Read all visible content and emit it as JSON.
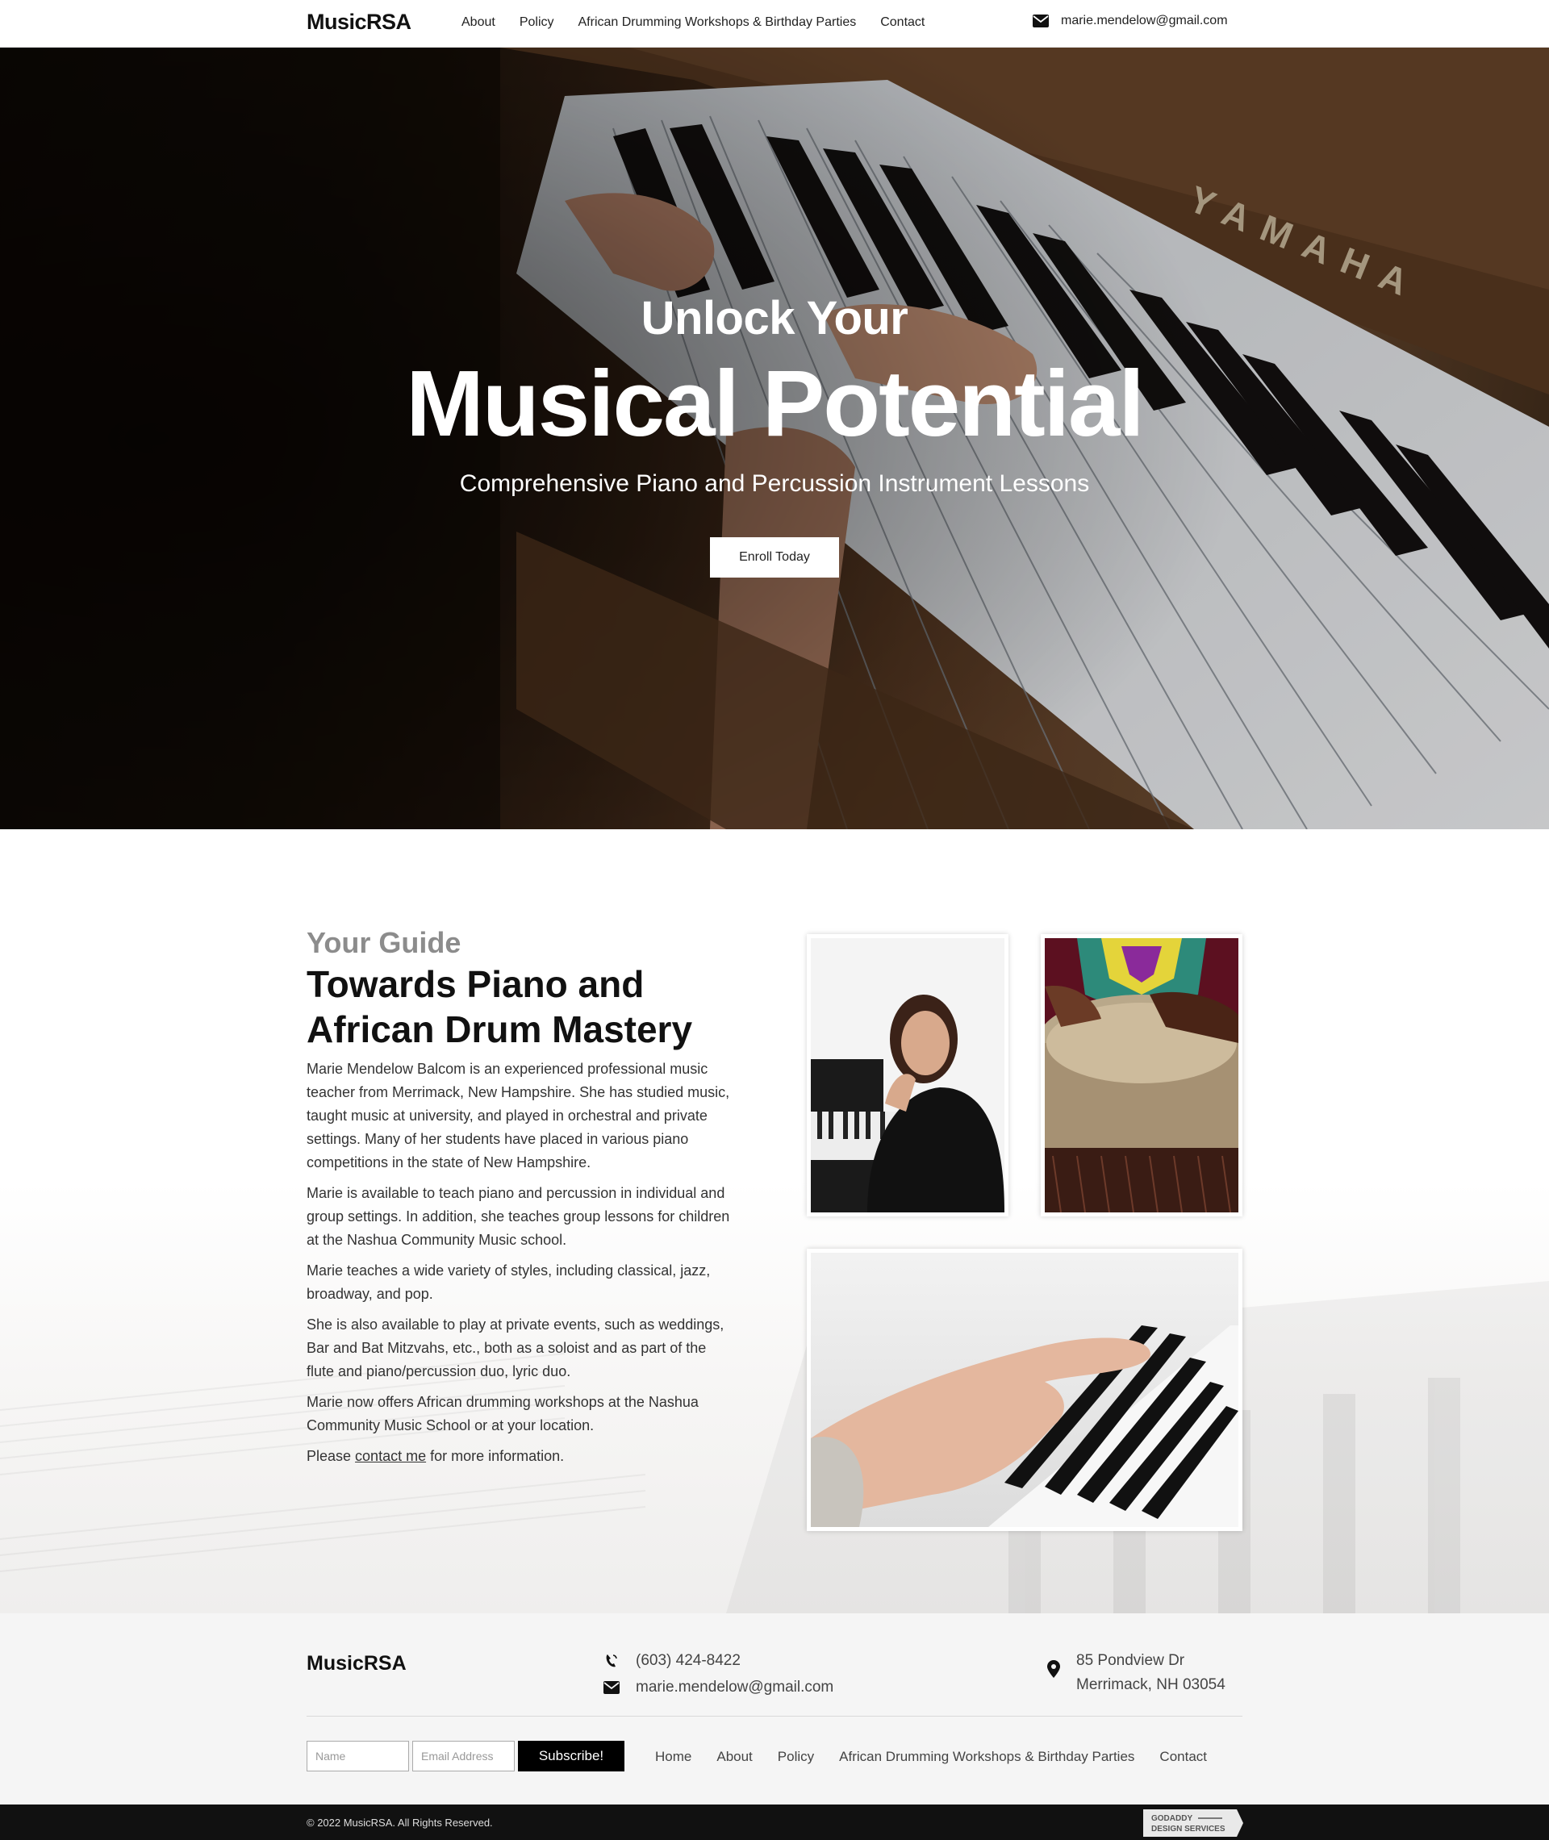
{
  "nav": {
    "logo": "MusicRSA",
    "items": [
      {
        "label": "About"
      },
      {
        "label": "Policy"
      },
      {
        "label": "African Drumming Workshops & Birthday Parties"
      },
      {
        "label": "Contact"
      }
    ],
    "email": "marie.mendelow@gmail.com"
  },
  "hero": {
    "line1": "Unlock Your",
    "line2": "Musical Potential",
    "subtitle": "Comprehensive Piano and Percussion Instrument Lessons",
    "cta": "Enroll Today",
    "brand_on_piano": "YAMAHA"
  },
  "about": {
    "eyebrow": "Your Guide",
    "title": "Towards Piano and African Drum Mastery",
    "paragraphs": [
      "Marie Mendelow Balcom is an experienced professional music teacher from Merrimack, New Hampshire. She has studied music, taught music at university, and played in orchestral and private settings. Many of her students have placed in various piano competitions in the state of New Hampshire.",
      "Marie is available to teach piano and percussion in individual and group settings. In addition, she teaches group lessons for children at the Nashua Community Music school.",
      "Marie teaches a wide variety of styles, including classical, jazz, broadway, and pop.",
      "She is also available to play at private events, such as weddings, Bar and Bat Mitzvahs, etc., both as a soloist and as part of the flute and piano/percussion duo, lyric duo.",
      "Marie now offers African drumming workshops at the Nashua Community Music School or at your location."
    ],
    "last_prefix": "Please ",
    "last_link": "contact me",
    "last_suffix": " for more information."
  },
  "footer": {
    "logo": "MusicRSA",
    "phone": "(603) 424-8422",
    "email": "marie.mendelow@gmail.com",
    "address_line1": "85 Pondview Dr",
    "address_line2": "Merrimack, NH 03054",
    "name_placeholder": "Name",
    "email_placeholder": "Email Address",
    "subscribe": "Subscribe!",
    "menu": [
      {
        "label": "Home"
      },
      {
        "label": "About"
      },
      {
        "label": "Policy"
      },
      {
        "label": "African Drumming Workshops & Birthday Parties"
      },
      {
        "label": "Contact"
      }
    ],
    "copyright": "© 2022 MusicRSA. All Rights Reserved.",
    "badge_line1": "GODADDY",
    "badge_line2": "DESIGN SERVICES"
  },
  "colors": {
    "accent": "#000000",
    "eyebrow": "#8c8c8c",
    "footer_bg": "#f5f5f5",
    "bottom_bar": "#111111"
  }
}
